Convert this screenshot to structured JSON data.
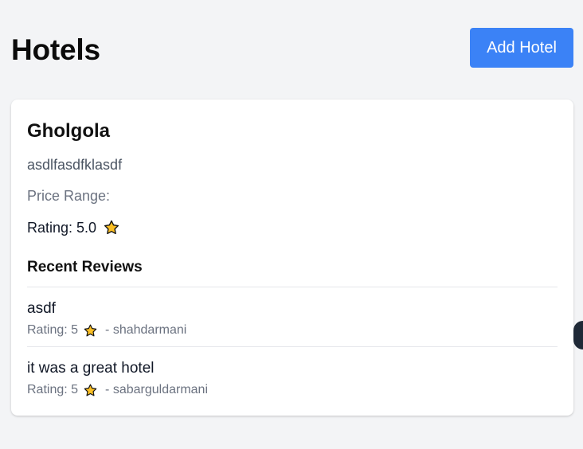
{
  "page": {
    "title": "Hotels",
    "add_hotel_label": "Add Hotel"
  },
  "hotel": {
    "name": "Gholgola",
    "description": "asdlfasdfklasdf",
    "price_range_label": "Price Range:",
    "rating_label": "Rating: 5.0",
    "recent_reviews_heading": "Recent Reviews",
    "reviews": [
      {
        "comment": "asdf",
        "rating_label": "Rating: 5",
        "author": "- shahdarmani"
      },
      {
        "comment": "it was a great hotel",
        "rating_label": "Rating: 5",
        "author": "- sabarguldarmani"
      }
    ]
  },
  "icons": {
    "star": "star-icon",
    "edge": "floating-control"
  },
  "colors": {
    "background": "#f3f4f6",
    "primary": "#3b82f6",
    "card": "#ffffff",
    "text": "#111827",
    "muted": "#6b7280",
    "star_fill": "#fbbf24",
    "star_stroke": "#111111"
  }
}
